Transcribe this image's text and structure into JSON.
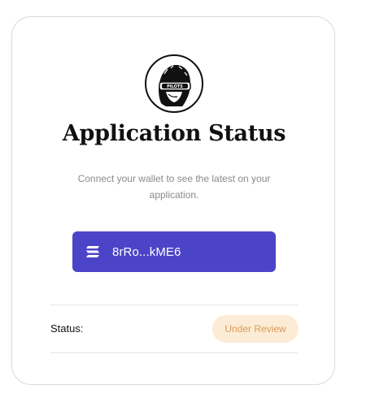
{
  "card": {
    "logo_name": "PILOTS",
    "title": "Application Status",
    "subtitle": "Connect your wallet to see the latest on your application."
  },
  "wallet": {
    "address": "8rRo...kME6",
    "icon": "solana-icon",
    "bg_color": "#4c44c8"
  },
  "status": {
    "label": "Status:",
    "value": "Under Review",
    "badge_bg": "#fdecd5",
    "badge_color": "#d99a55"
  }
}
